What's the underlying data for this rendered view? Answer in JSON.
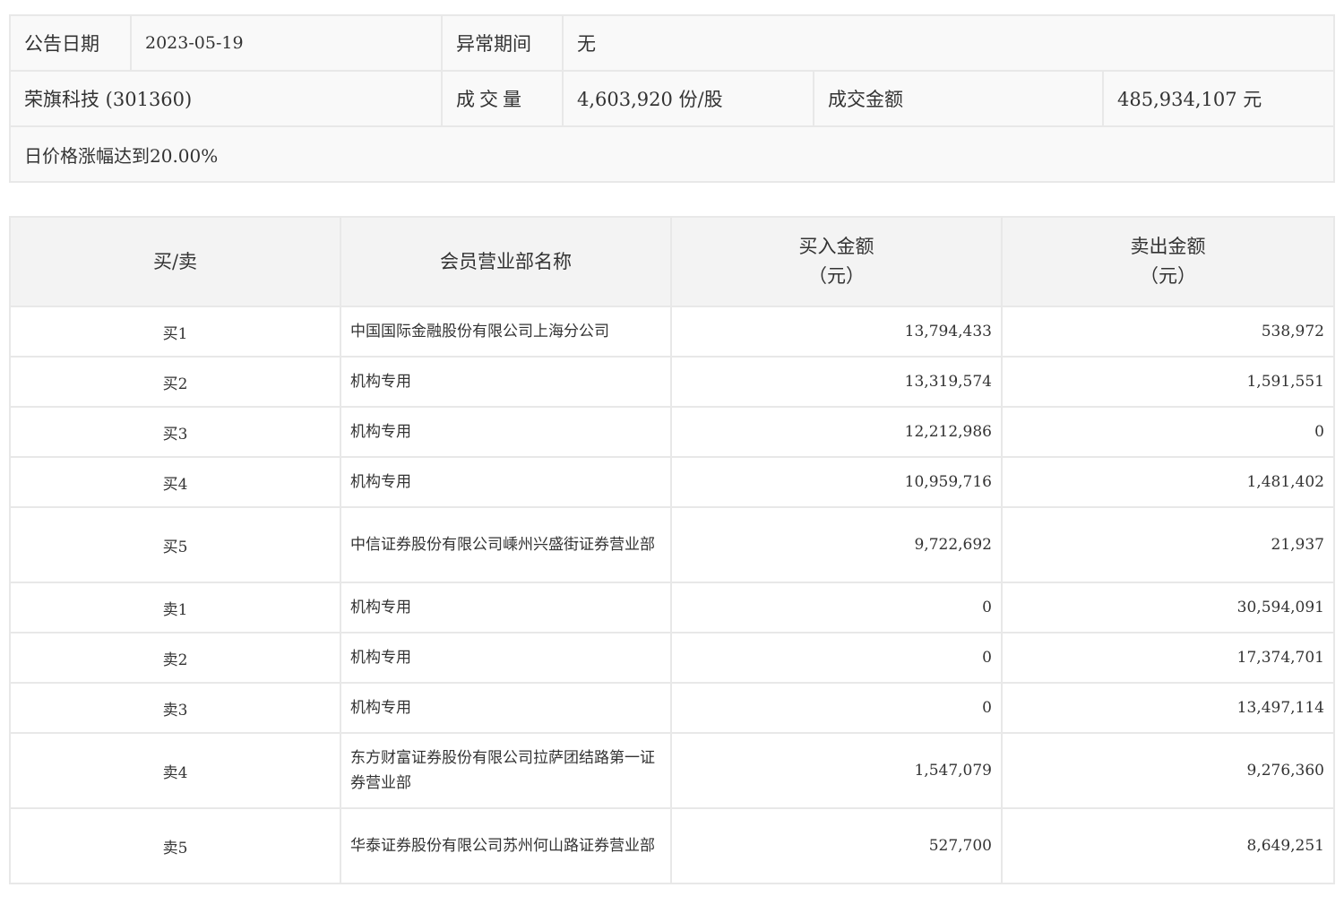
{
  "info": {
    "date_label": "公告日期",
    "date_value": "2023-05-19",
    "period_label": "异常期间",
    "period_value": "无",
    "stock_name": "荣旗科技 (301360)",
    "volume_label": "成交量",
    "volume_value": "4,603,920 份/股",
    "amount_label": "成交金额",
    "amount_value": "485,934,107 元",
    "reason": "日价格涨幅达到20.00%"
  },
  "table": {
    "headers": {
      "side": "买/卖",
      "name": "会员营业部名称",
      "buy_title": "买入金额",
      "buy_unit": "（元）",
      "sell_title": "卖出金额",
      "sell_unit": "（元）"
    },
    "rows": [
      {
        "side": "买1",
        "name": "中国国际金融股份有限公司上海分公司",
        "buy": "13,794,433",
        "sell": "538,972"
      },
      {
        "side": "买2",
        "name": "机构专用",
        "buy": "13,319,574",
        "sell": "1,591,551"
      },
      {
        "side": "买3",
        "name": "机构专用",
        "buy": "12,212,986",
        "sell": "0"
      },
      {
        "side": "买4",
        "name": "机构专用",
        "buy": "10,959,716",
        "sell": "1,481,402"
      },
      {
        "side": "买5",
        "name": "中信证券股份有限公司嵊州兴盛街证券营业部",
        "buy": "9,722,692",
        "sell": "21,937"
      },
      {
        "side": "卖1",
        "name": "机构专用",
        "buy": "0",
        "sell": "30,594,091"
      },
      {
        "side": "卖2",
        "name": "机构专用",
        "buy": "0",
        "sell": "17,374,701"
      },
      {
        "side": "卖3",
        "name": "机构专用",
        "buy": "0",
        "sell": "13,497,114"
      },
      {
        "side": "卖4",
        "name": "东方财富证券股份有限公司拉萨团结路第一证券营业部",
        "buy": "1,547,079",
        "sell": "9,276,360"
      },
      {
        "side": "卖5",
        "name": "华泰证券股份有限公司苏州何山路证券营业部",
        "buy": "527,700",
        "sell": "8,649,251"
      }
    ]
  }
}
